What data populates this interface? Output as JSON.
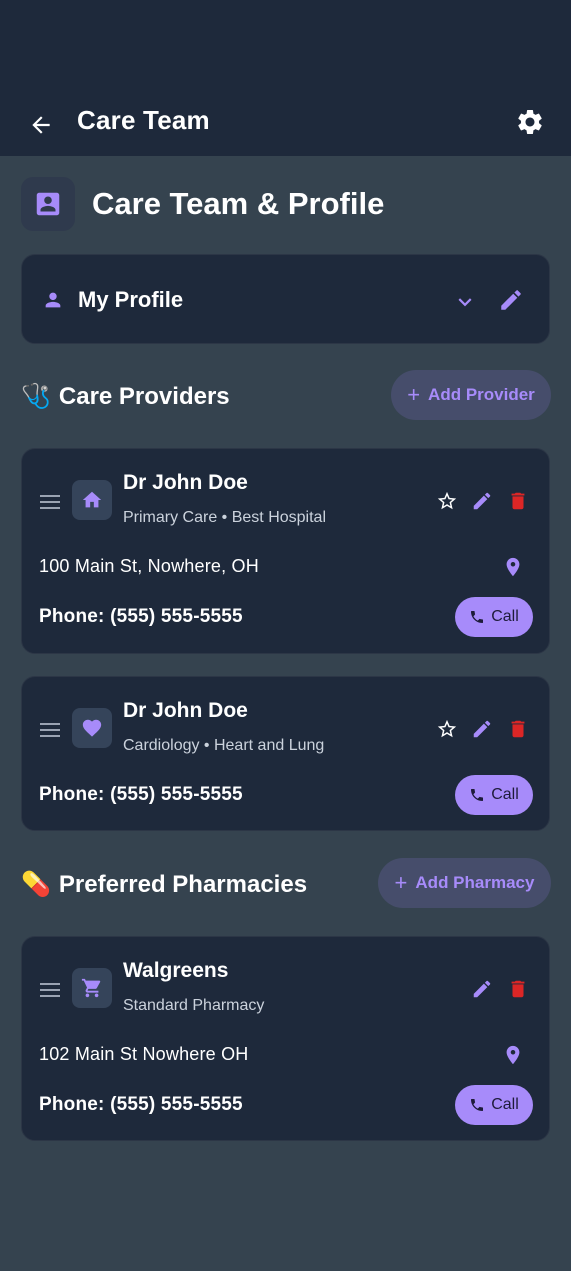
{
  "appbar": {
    "title": "Care Team",
    "back_icon": "arrow-back-icon",
    "settings_icon": "gear-icon"
  },
  "header": {
    "title": "Care Team & Profile",
    "icon": "contact-card-icon"
  },
  "profile": {
    "label": "My Profile"
  },
  "providers_section": {
    "emoji": "🩺",
    "title": "Care Providers",
    "add_label": "Add Provider"
  },
  "providers": [
    {
      "name": "Dr John Doe",
      "subtitle": "Primary Care • Best Hospital",
      "icon": "home-icon",
      "address": "100 Main St, Nowhere, OH",
      "phone": "Phone: (555) 555-5555",
      "call_label": "Call"
    },
    {
      "name": "Dr John Doe",
      "subtitle": "Cardiology • Heart and Lung",
      "icon": "heart-icon",
      "phone": "Phone: (555) 555-5555",
      "call_label": "Call"
    }
  ],
  "pharmacies_section": {
    "emoji": "💊",
    "title": "Preferred Pharmacies",
    "add_label": "Add Pharmacy"
  },
  "pharmacies": [
    {
      "name": "Walgreens",
      "subtitle": "Standard Pharmacy",
      "icon": "cart-icon",
      "address": "102 Main St Nowhere OH",
      "phone": "Phone: (555) 555-5555",
      "call_label": "Call"
    }
  ],
  "colors": {
    "accent": "#a78bfa",
    "danger": "#dc2626",
    "card": "#1e293b",
    "background": "#35434f"
  }
}
